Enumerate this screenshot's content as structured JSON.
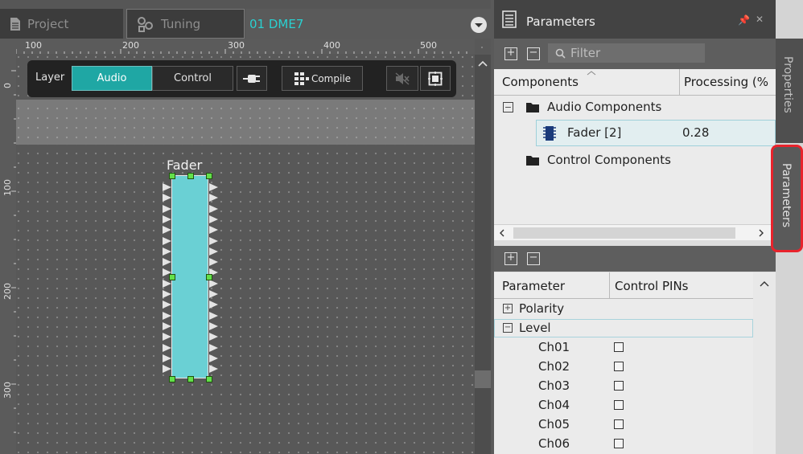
{
  "tabs": {
    "project": "Project",
    "tuning": "Tuning",
    "active": "01 DME7"
  },
  "ruler": {
    "h_labels": [
      "100",
      "200",
      "300",
      "400",
      "500"
    ],
    "v_labels": [
      "0",
      "100",
      "200",
      "300"
    ]
  },
  "toolbar": {
    "layer_label": "Layer",
    "audio_label": "Audio",
    "control_label": "Control",
    "compile_label": "Compile"
  },
  "component": {
    "title": "Fader"
  },
  "panel": {
    "title": "Parameters",
    "filter_placeholder": "Filter",
    "columns": {
      "components": "Components",
      "processing": "Processing (%"
    },
    "components": {
      "audio_group": "Audio Components",
      "fader_name": "Fader [2]",
      "fader_value": "0.28",
      "control_group": "Control Components"
    },
    "param_columns": {
      "parameter": "Parameter",
      "control_pins": "Control PINs"
    },
    "params": {
      "polarity": "Polarity",
      "level": "Level",
      "channels": [
        "Ch01",
        "Ch02",
        "Ch03",
        "Ch04",
        "Ch05",
        "Ch06"
      ]
    }
  },
  "side_tabs": {
    "properties": "Properties",
    "parameters": "Parameters"
  },
  "colors": {
    "accent_teal": "#1fa7a4",
    "fader_fill": "#6ad0d4",
    "highlight_red": "#e8232c"
  }
}
